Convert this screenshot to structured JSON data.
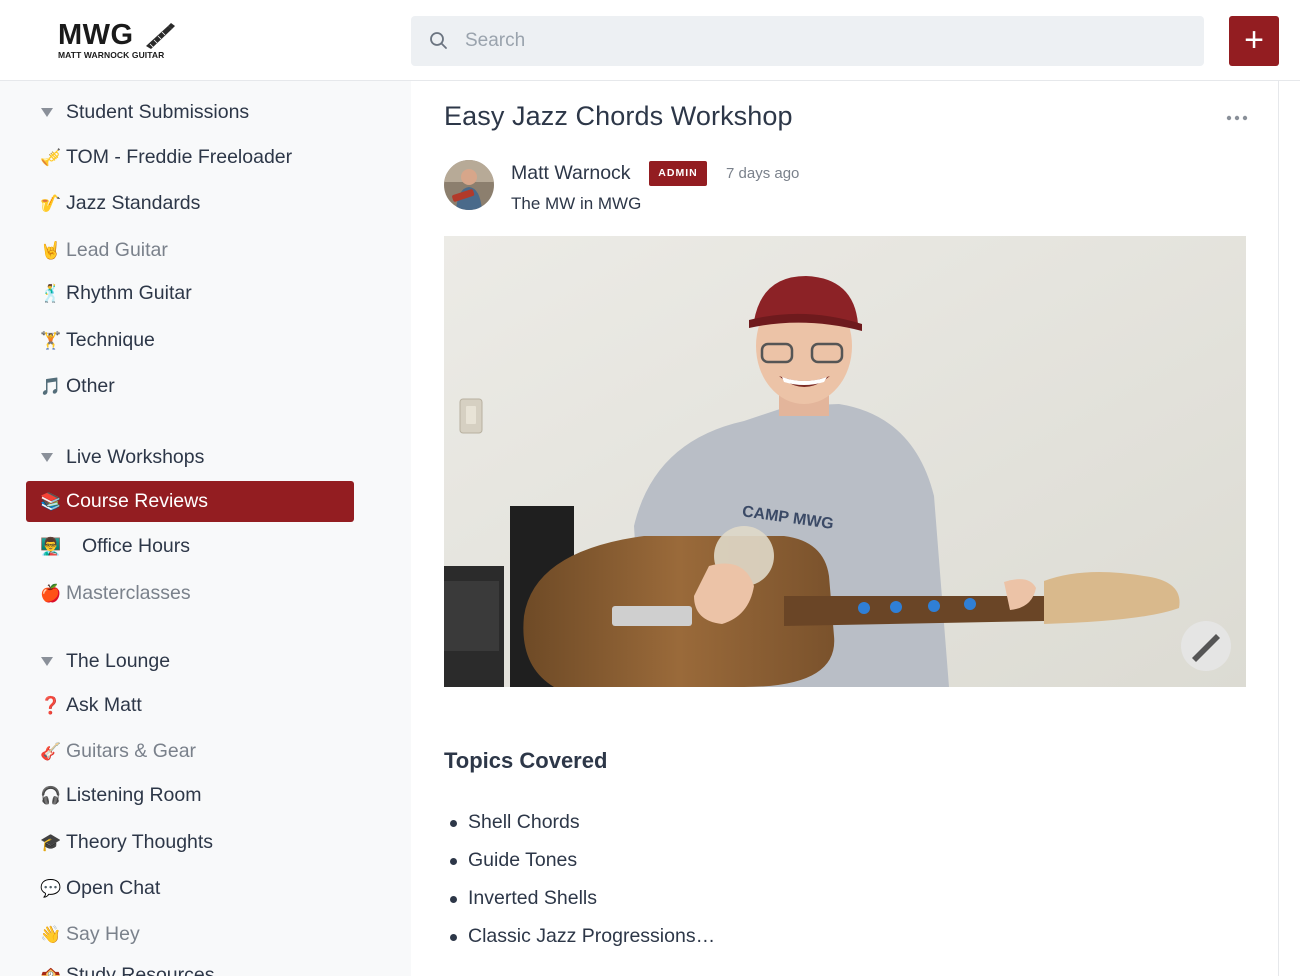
{
  "header": {
    "logo_text": "MWG",
    "logo_subtext": "MATT WARNOCK GUITAR",
    "search_placeholder": "Search",
    "new_button_label": "+"
  },
  "sidebar": {
    "sections": [
      {
        "title": "Student Submissions",
        "items": [
          {
            "emoji": "🎺",
            "label": "TOM - Freddie Freeloader",
            "muted": false
          },
          {
            "emoji": "🎷",
            "label": "Jazz Standards",
            "muted": false
          },
          {
            "emoji": "🤘",
            "label": "Lead Guitar",
            "muted": true
          },
          {
            "emoji": "🕺",
            "label": "Rhythm Guitar",
            "muted": false
          },
          {
            "emoji": "🏋",
            "label": "Technique",
            "muted": false
          },
          {
            "emoji": "🎵",
            "label": "Other",
            "muted": false
          }
        ]
      },
      {
        "title": "Live Workshops",
        "items": [
          {
            "emoji": "📚",
            "label": "Course Reviews",
            "active": true
          },
          {
            "emoji": "👨‍🏫",
            "label": "Office Hours",
            "muted": false
          },
          {
            "emoji": "🍎",
            "label": "Masterclasses",
            "muted": true
          }
        ]
      },
      {
        "title": "The Lounge",
        "items": [
          {
            "emoji": "❓",
            "label": "Ask Matt",
            "muted": false
          },
          {
            "emoji": "🎸",
            "label": "Guitars & Gear",
            "muted": true
          },
          {
            "emoji": "🎧",
            "label": "Listening Room",
            "muted": false
          },
          {
            "emoji": "🎓",
            "label": "Theory Thoughts",
            "muted": false
          },
          {
            "emoji": "💬",
            "label": "Open Chat",
            "muted": false
          },
          {
            "emoji": "👋",
            "label": "Say Hey",
            "muted": true
          },
          {
            "emoji": "🏫",
            "label": "Study Resources",
            "muted": false
          }
        ]
      }
    ]
  },
  "post": {
    "title": "Easy Jazz Chords Workshop",
    "author": "Matt Warnock",
    "badge": "ADMIN",
    "time": "7 days ago",
    "author_tagline": "The MW in MWG",
    "video_shirt_text": "CAMP MWG",
    "section_title": "Topics Covered",
    "topics": [
      "Shell Chords",
      "Guide Tones",
      "Inverted Shells",
      "Classic Jazz Progressions…"
    ]
  },
  "colors": {
    "brand": "#931d21",
    "sidebar_bg": "#f8f9fa",
    "search_bg": "#edf0f3",
    "text": "#2d3748",
    "muted": "#7a818b"
  }
}
